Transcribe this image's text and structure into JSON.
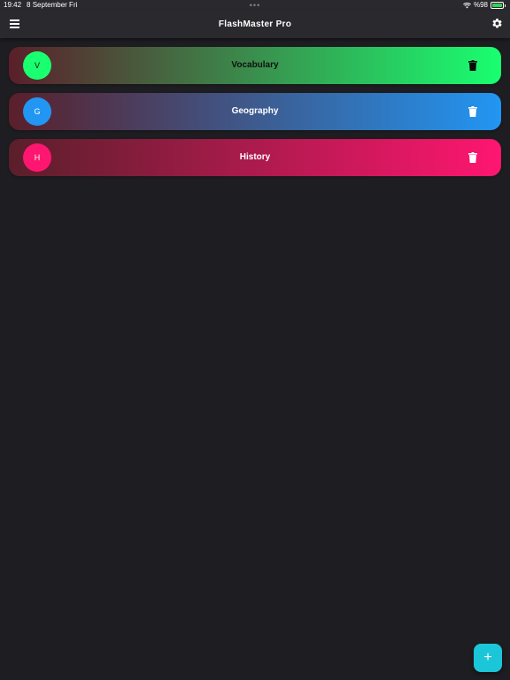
{
  "status_bar": {
    "time": "19:42",
    "date": "8 September Fri",
    "dots": "•••",
    "battery": "%98",
    "battery_level_pct": 98
  },
  "app_bar": {
    "title": "FlashMaster Pro",
    "menu_icon": "menu-icon",
    "settings_icon": "gear-icon"
  },
  "decks": [
    {
      "initial": "V",
      "title": "Vocabulary",
      "accent": "#19ff70",
      "title_color": "#111111",
      "avatar_text_color": "#111111"
    },
    {
      "initial": "G",
      "title": "Geography",
      "accent": "#2196f3",
      "title_color": "#ffffff",
      "avatar_text_color": "#ffffff"
    },
    {
      "initial": "H",
      "title": "History",
      "accent": "#ff1670",
      "title_color": "#ffffff",
      "avatar_text_color": "#ffffff"
    }
  ],
  "deck_action_icon": "trash-icon",
  "fab": {
    "label": "+",
    "icon": "plus-icon",
    "color": "#1cc6d9"
  }
}
